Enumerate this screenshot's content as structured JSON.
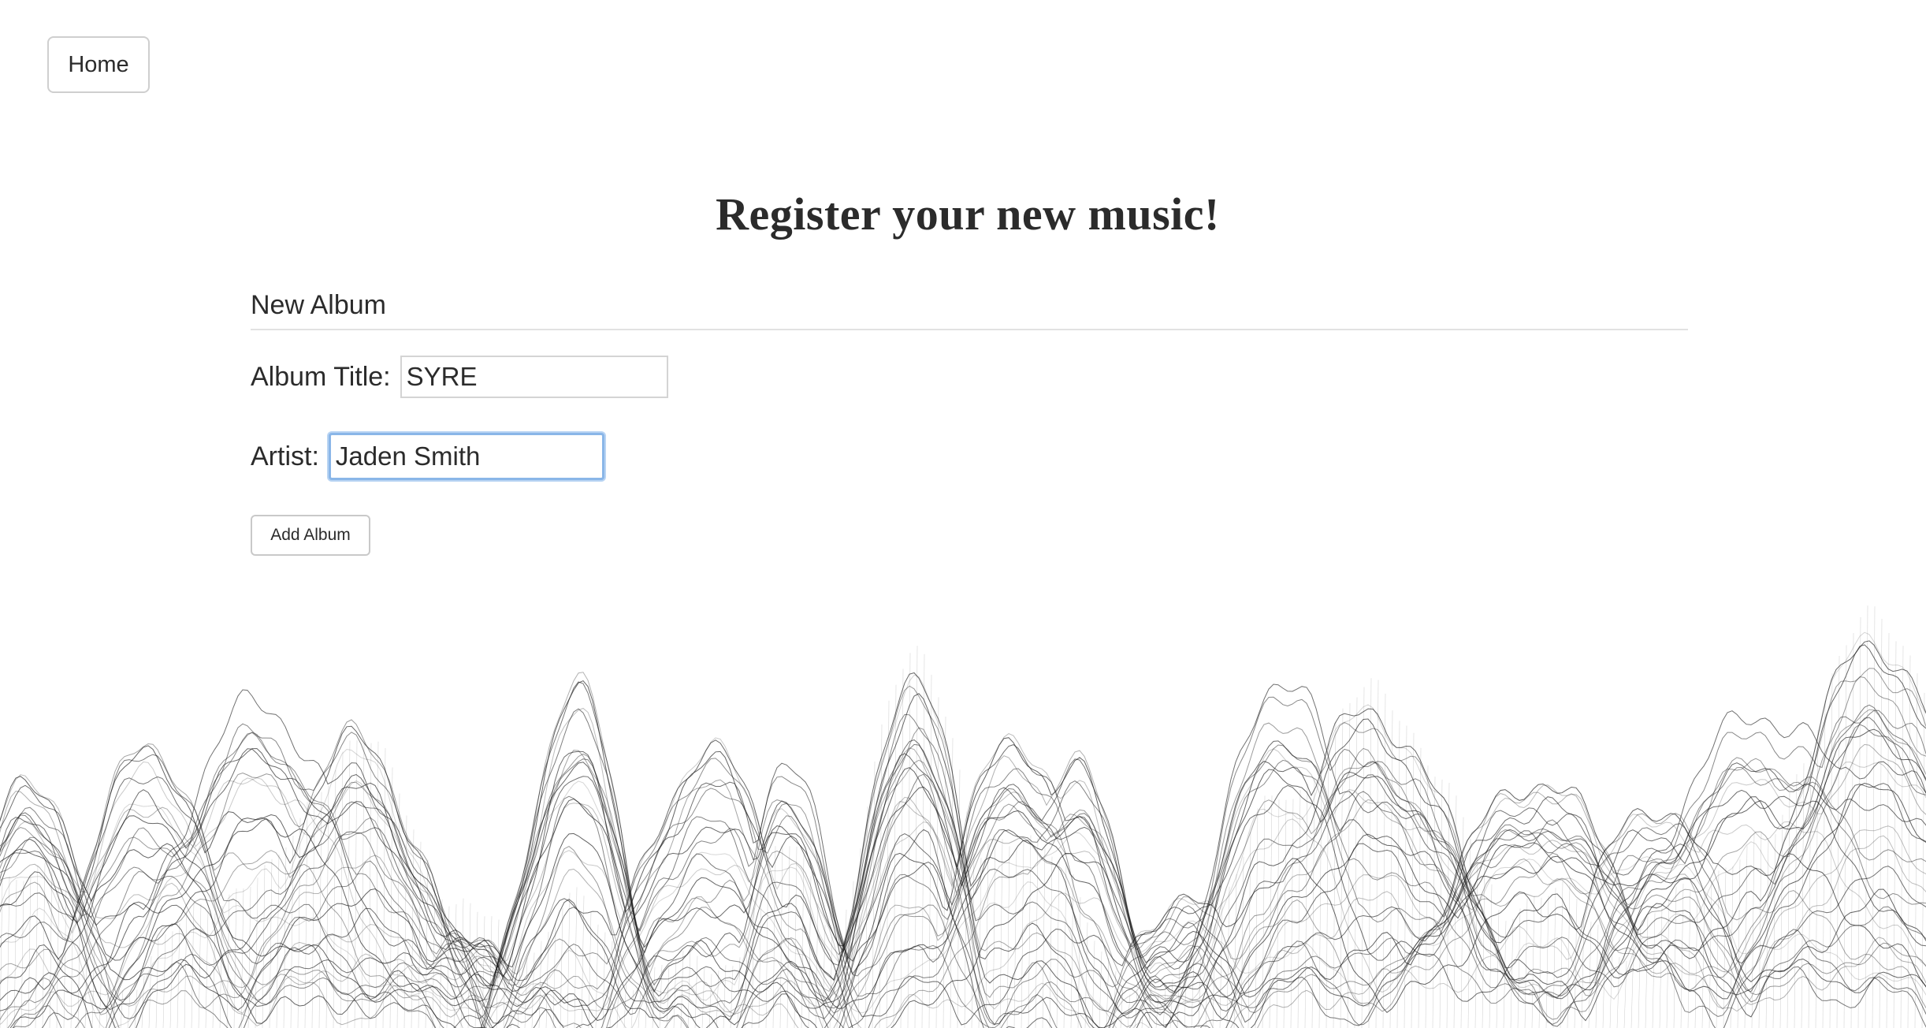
{
  "nav": {
    "home_label": "Home"
  },
  "page": {
    "title": "Register your new music!"
  },
  "form": {
    "legend": "New Album",
    "album_title_label": "Album Title:",
    "album_title_value": "SYRE",
    "artist_label": "Artist:",
    "artist_value": "Jaden Smith",
    "submit_label": "Add Album"
  },
  "background": {
    "image": "wireframe-mountains-art",
    "stroke_color": "#1a1a1a"
  }
}
